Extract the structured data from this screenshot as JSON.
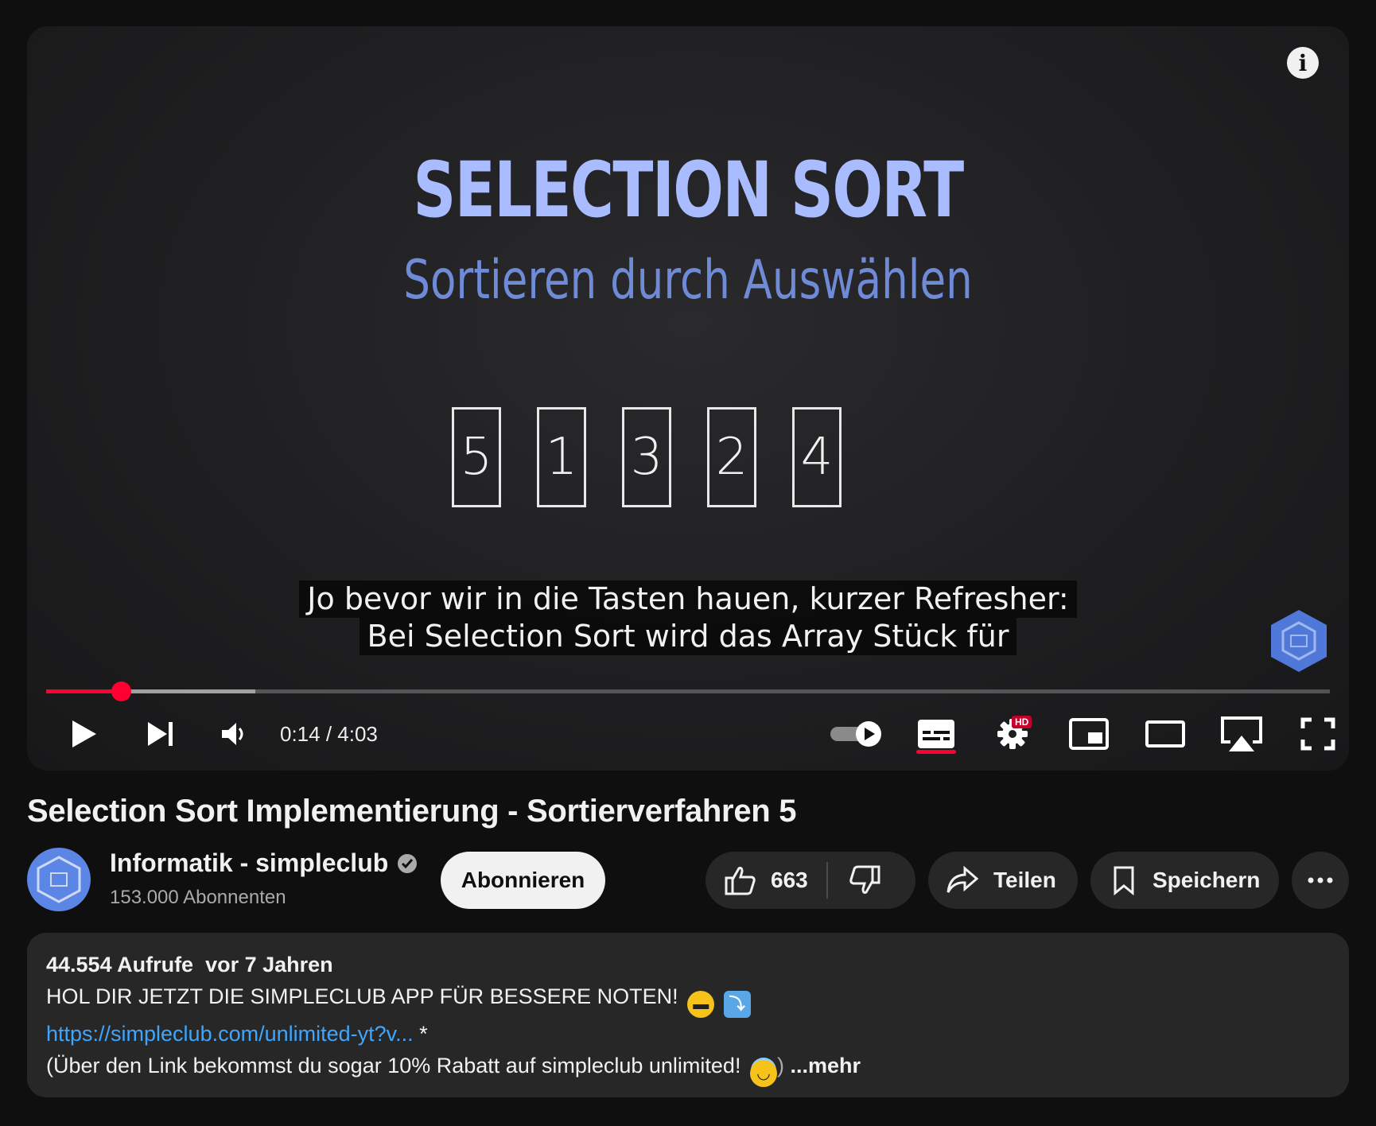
{
  "video": {
    "slide_title": "SELECTION SORT",
    "slide_subtitle": "Sortieren durch Auswählen",
    "array": [
      "5",
      "1",
      "3",
      "2",
      "4"
    ],
    "captions": [
      "Jo bevor wir in die Tasten hauen, kurzer Refresher:",
      "Bei Selection Sort wird das Array Stück für"
    ],
    "info_label": "i"
  },
  "player": {
    "current_time": "0:14",
    "duration": "4:03",
    "time_display": "0:14 / 4:03",
    "played_fraction": 0.058,
    "buffered_fraction": 0.163,
    "hd_badge": "HD",
    "accent_color": "#ff0033",
    "icons": [
      "play-icon",
      "next-icon",
      "volume-icon",
      "autoplay-toggle-icon",
      "subtitles-icon",
      "settings-icon",
      "miniplayer-icon",
      "theater-icon",
      "airplay-icon",
      "fullscreen-icon"
    ]
  },
  "title": "Selection Sort Implementierung - Sortierverfahren 5",
  "channel": {
    "name": "Informatik - simpleclub",
    "subscribers": "153.000 Abonnenten",
    "subscribe_label": "Abonnieren"
  },
  "actions": {
    "likes": "663",
    "share_label": "Teilen",
    "save_label": "Speichern"
  },
  "description": {
    "views": "44.554 Aufrufe",
    "age": "vor 7 Jahren",
    "line1": "HOL DIR JETZT DIE SIMPLECLUB APP FÜR BESSERE NOTEN!",
    "link": "https://simpleclub.com/unlimited-yt?v...",
    "link_suffix": " *",
    "line3": "(Über den Link bekommst du sogar 10% Rabatt auf simpleclub unlimited!",
    "line3_suffix": ")",
    "more_label": " ...mehr"
  }
}
